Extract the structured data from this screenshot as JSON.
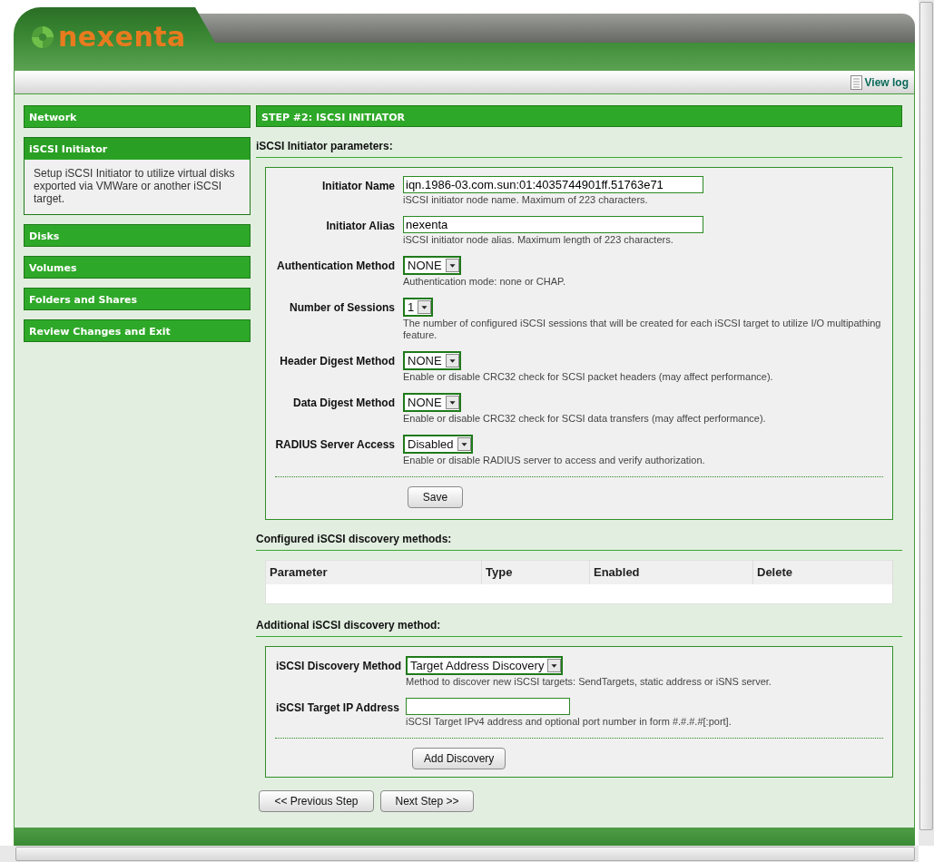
{
  "header": {
    "logo": "nexenta"
  },
  "toolbar": {
    "view_log": "View log"
  },
  "sidebar": {
    "items": [
      {
        "label": "Network",
        "selected": false
      },
      {
        "label": "iSCSI Initiator",
        "selected": true,
        "description": "Setup iSCSI Initiator to utilize virtual disks exported via VMWare or another iSCSI target."
      },
      {
        "label": "Disks",
        "selected": false
      },
      {
        "label": "Volumes",
        "selected": false
      },
      {
        "label": "Folders and Shares",
        "selected": false
      },
      {
        "label": "Review Changes and Exit",
        "selected": false
      }
    ]
  },
  "step_title": "STEP #2: ISCSI INITIATOR",
  "parameters": {
    "title": "iSCSI Initiator parameters:",
    "fields": [
      {
        "kind": "text",
        "label": "Initiator Name",
        "value": "iqn.1986-03.com.sun:01:4035744901ff.51763e71",
        "hint": "iSCSI initiator node name. Maximum of 223 characters."
      },
      {
        "kind": "text",
        "label": "Initiator Alias",
        "value": "nexenta",
        "hint": "iSCSI initiator node alias. Maximum length of 223 characters."
      },
      {
        "kind": "select",
        "label": "Authentication Method",
        "value": "NONE",
        "hint": "Authentication mode: none or CHAP."
      },
      {
        "kind": "select",
        "label": "Number of Sessions",
        "value": "1",
        "hint": "The number of configured iSCSI sessions that will be created for each iSCSI target to utilize I/O multipathing feature."
      },
      {
        "kind": "select",
        "label": "Header Digest Method",
        "value": "NONE",
        "hint": "Enable or disable CRC32 check for SCSI packet headers (may affect performance)."
      },
      {
        "kind": "select",
        "label": "Data Digest Method",
        "value": "NONE",
        "hint": "Enable or disable CRC32 check for SCSI data transfers (may affect performance)."
      },
      {
        "kind": "select",
        "label": "RADIUS Server Access",
        "value": "Disabled",
        "hint": "Enable or disable RADIUS server to access and verify authorization."
      }
    ],
    "button": "Save"
  },
  "discovery_methods": {
    "title": "Configured iSCSI discovery methods:",
    "columns": [
      "Parameter",
      "Type",
      "Enabled",
      "Delete"
    ]
  },
  "additional": {
    "title": "Additional iSCSI discovery method:",
    "fields": [
      {
        "kind": "select",
        "label": "iSCSI Discovery Method",
        "value": "Target Address Discovery",
        "hint": "Method to discover new iSCSI targets: SendTargets, static address or iSNS server."
      },
      {
        "kind": "text",
        "label": "iSCSI Target IP Address",
        "hint": "iSCSI Target IPv4 address and optional port number in form #.#.#.#[:port]."
      }
    ],
    "button": "Add Discovery"
  },
  "nav_buttons": [
    "<< Previous Step",
    "Next Step >>"
  ]
}
